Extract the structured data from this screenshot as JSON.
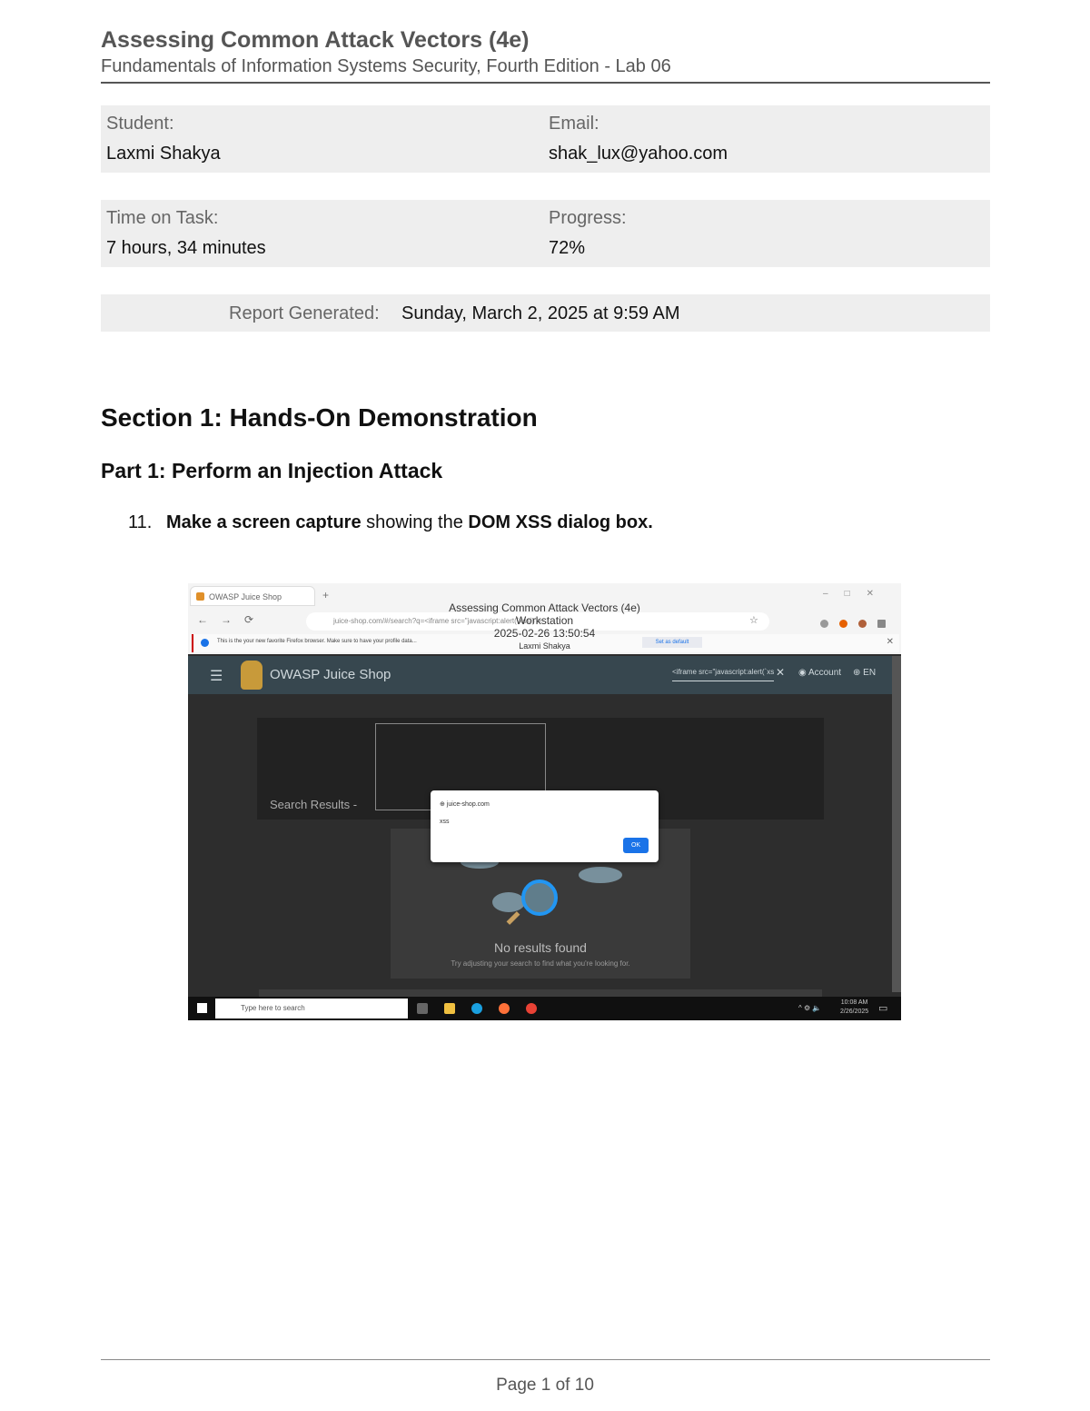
{
  "header": {
    "title": "Assessing Common Attack Vectors (4e)",
    "subtitle": "Fundamentals of Information Systems Security, Fourth Edition - Lab 06"
  },
  "student_info": {
    "student_label": "Student:",
    "student_value": "Laxmi Shakya",
    "email_label": "Email:",
    "email_value": "shak_lux@yahoo.com",
    "time_label": "Time on Task:",
    "time_value": "7 hours, 34 minutes",
    "progress_label": "Progress:",
    "progress_value": "72%",
    "report_label": "Report Generated:",
    "report_value": "Sunday, March 2, 2025 at 9:59 AM"
  },
  "section": {
    "heading": "Section 1: Hands-On Demonstration",
    "part_heading": "Part 1: Perform an Injection Attack",
    "step_number": "11.",
    "step_bold1": "Make a screen capture",
    "step_text1": " showing the ",
    "step_bold2": "DOM XSS dialog box."
  },
  "screenshot": {
    "tab_label": "OWASP Juice Shop",
    "url_text": "juice-shop.com/#/search?q=<iframe src=\"javascript:alert(`xss`)\">",
    "infobar_text": "This is the your new favorite Firefox browser. Make sure to have your profile data...",
    "infobar_button": "Set as default",
    "watermark_lines": [
      "Assessing Common Attack Vectors (4e)",
      "Workstation",
      "2025-02-26 13:50:54",
      "Laxmi Shakya"
    ],
    "app_title": "OWASP Juice Shop",
    "search_value": "<iframe src=\"javascript:alert(`xss`)\">",
    "account_label": "Account",
    "lang_label": "EN",
    "results_label": "Search Results -",
    "dialog_title": "juice-shop.com",
    "dialog_message": "xss",
    "dialog_ok": "OK",
    "no_results_title": "No results found",
    "no_results_sub": "Try adjusting your search to find what you're looking for.",
    "taskbar_search": "Type here to search",
    "clock_time": "10:08 AM",
    "clock_date": "2/26/2025"
  },
  "footer": {
    "page_word": "Page",
    "page_num": "1",
    "of_word": "of",
    "page_total": "10"
  },
  "colors": {
    "header_gray": "#555555",
    "infobox_bg": "#eeeeee",
    "juice_appbar": "#37474f",
    "dialog_ok": "#1a73e8"
  }
}
